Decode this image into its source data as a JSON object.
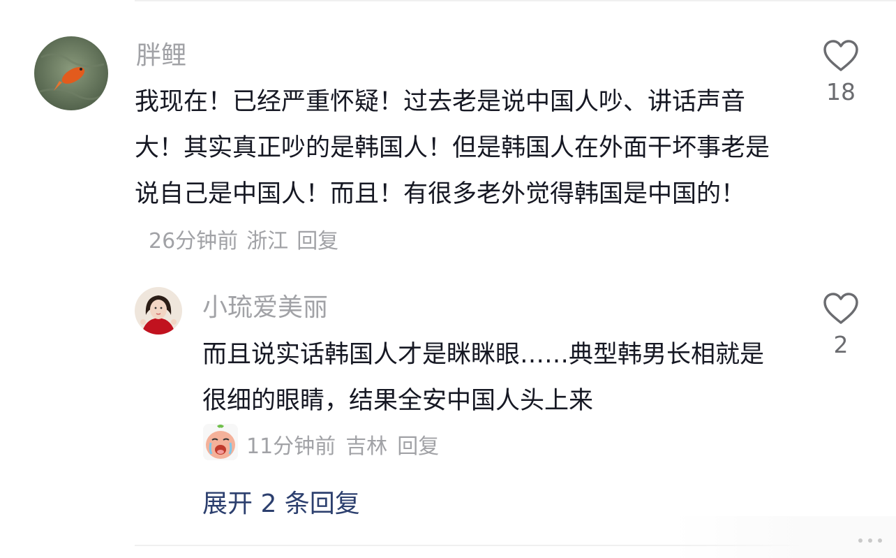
{
  "comment": {
    "author": "胖鲤",
    "text": "我现在！已经严重怀疑！过去老是说中国人吵、讲话声音大！其实真正吵的是韩国人！但是韩国人在外面干坏事老是说自己是中国人！而且！有很多老外觉得韩国是中国的！",
    "time": "26分钟前",
    "location": "浙江",
    "reply_label": "回复",
    "likes": "18",
    "avatar_icon": "koi-fish-avatar",
    "like_icon": "heart-outline-icon"
  },
  "reply": {
    "author": "小琉爱美丽",
    "text": "而且说实话韩国人才是眯眯眼……典型韩男长相就是很细的眼睛，结果全安中国人头上来",
    "sticker_icon": "crying-emoji-sticker",
    "time": "11分钟前",
    "location": "吉林",
    "reply_label": "回复",
    "likes": "2",
    "like_icon": "heart-outline-icon"
  },
  "expand_label": "展开 2 条回复",
  "colors": {
    "text": "#161823",
    "meta": "#a1a2a6",
    "link": "#2c3f6e"
  }
}
